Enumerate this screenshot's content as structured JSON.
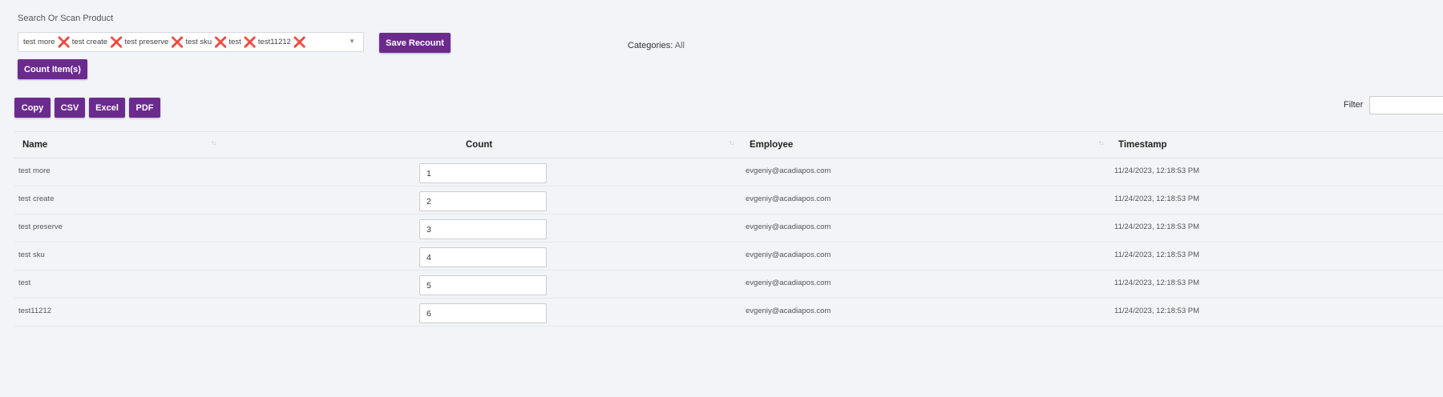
{
  "search": {
    "label": "Search Or Scan Product",
    "selected_items": [
      "test more",
      "test create",
      "test preserve",
      "test sku",
      "test",
      "test11212"
    ],
    "remove_glyph": "❌",
    "caret": "▼"
  },
  "buttons": {
    "save_recount": "Save Recount",
    "count_items": "Count Item(s)",
    "copy": "Copy",
    "csv": "CSV",
    "excel": "Excel",
    "pdf": "PDF"
  },
  "categories": {
    "label": "Categories:",
    "value": "All"
  },
  "filter": {
    "label": "Filter",
    "value": ""
  },
  "table": {
    "columns": [
      "Name",
      "Count",
      "Employee",
      "Timestamp"
    ],
    "sort_glyph": "↑↓",
    "rows": [
      {
        "name": "test more",
        "count": "1",
        "employee": "evgeniy@acadiapos.com",
        "timestamp": "11/24/2023, 12:18:53 PM"
      },
      {
        "name": "test create",
        "count": "2",
        "employee": "evgeniy@acadiapos.com",
        "timestamp": "11/24/2023, 12:18:53 PM"
      },
      {
        "name": "test preserve",
        "count": "3",
        "employee": "evgeniy@acadiapos.com",
        "timestamp": "11/24/2023, 12:18:53 PM"
      },
      {
        "name": "test sku",
        "count": "4",
        "employee": "evgeniy@acadiapos.com",
        "timestamp": "11/24/2023, 12:18:53 PM"
      },
      {
        "name": "test",
        "count": "5",
        "employee": "evgeniy@acadiapos.com",
        "timestamp": "11/24/2023, 12:18:53 PM"
      },
      {
        "name": "test11212",
        "count": "6",
        "employee": "evgeniy@acadiapos.com",
        "timestamp": "11/24/2023, 12:18:53 PM"
      }
    ]
  },
  "colors": {
    "accent": "#6b2a8e",
    "background": "#f2f4f8",
    "remove": "#d81b47"
  }
}
